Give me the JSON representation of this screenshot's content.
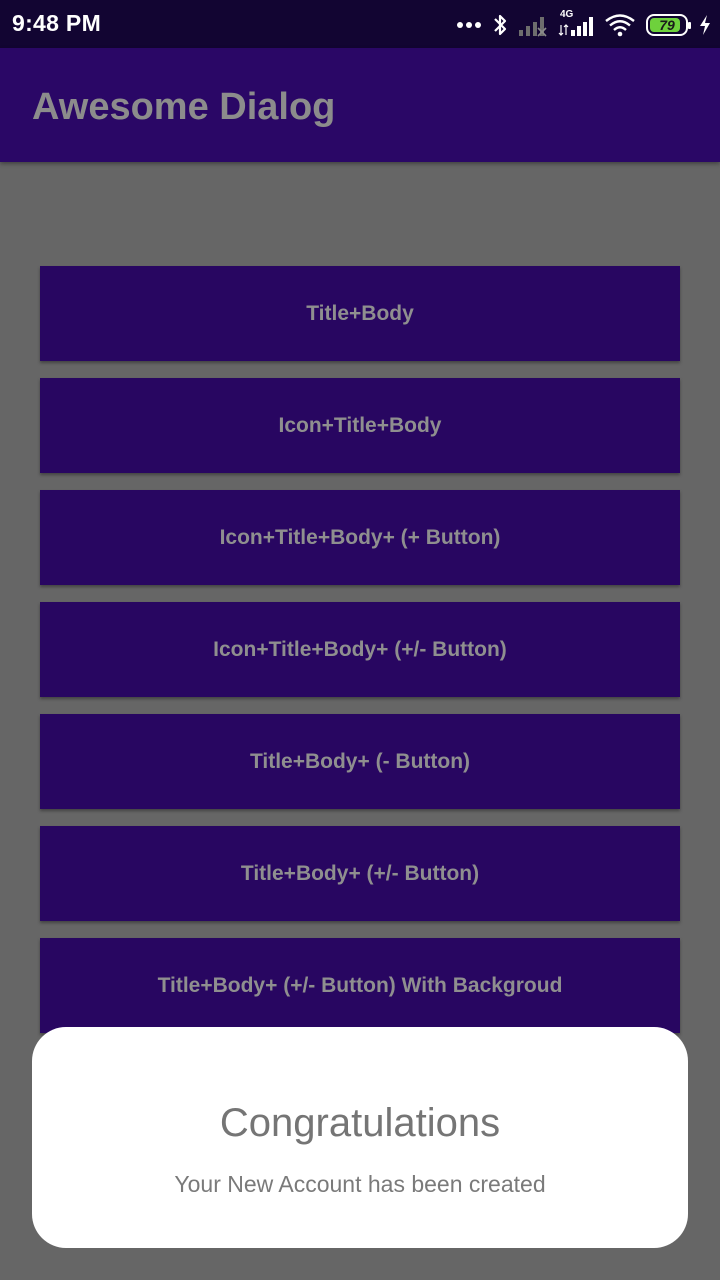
{
  "status_bar": {
    "time": "9:48 PM",
    "network_type": "4G",
    "battery_level": "79",
    "battery_fraction": 0.79,
    "icons": [
      "more-dots-icon",
      "bluetooth-icon",
      "signal-weak-icon",
      "signal-4g-icon",
      "wifi-icon",
      "battery-icon",
      "charging-icon"
    ]
  },
  "app_bar": {
    "title": "Awesome Dialog"
  },
  "buttons": [
    {
      "label": "Title+Body"
    },
    {
      "label": "Icon+Title+Body"
    },
    {
      "label": "Icon+Title+Body+ (+ Button)"
    },
    {
      "label": "Icon+Title+Body+ (+/- Button)"
    },
    {
      "label": "Title+Body+ (- Button)"
    },
    {
      "label": "Title+Body+ (+/- Button)"
    },
    {
      "label": "Title+Body+ (+/- Button) With Backgroud"
    },
    {
      "label": ""
    }
  ],
  "dialog": {
    "title": "Congratulations",
    "body": "Your New Account has been created"
  },
  "colors": {
    "status_bar_bg": "#120532",
    "app_bar_bg": "#2a0766",
    "button_bg": "#280661",
    "scrim": "#666666",
    "dialog_bg": "#ffffff"
  }
}
